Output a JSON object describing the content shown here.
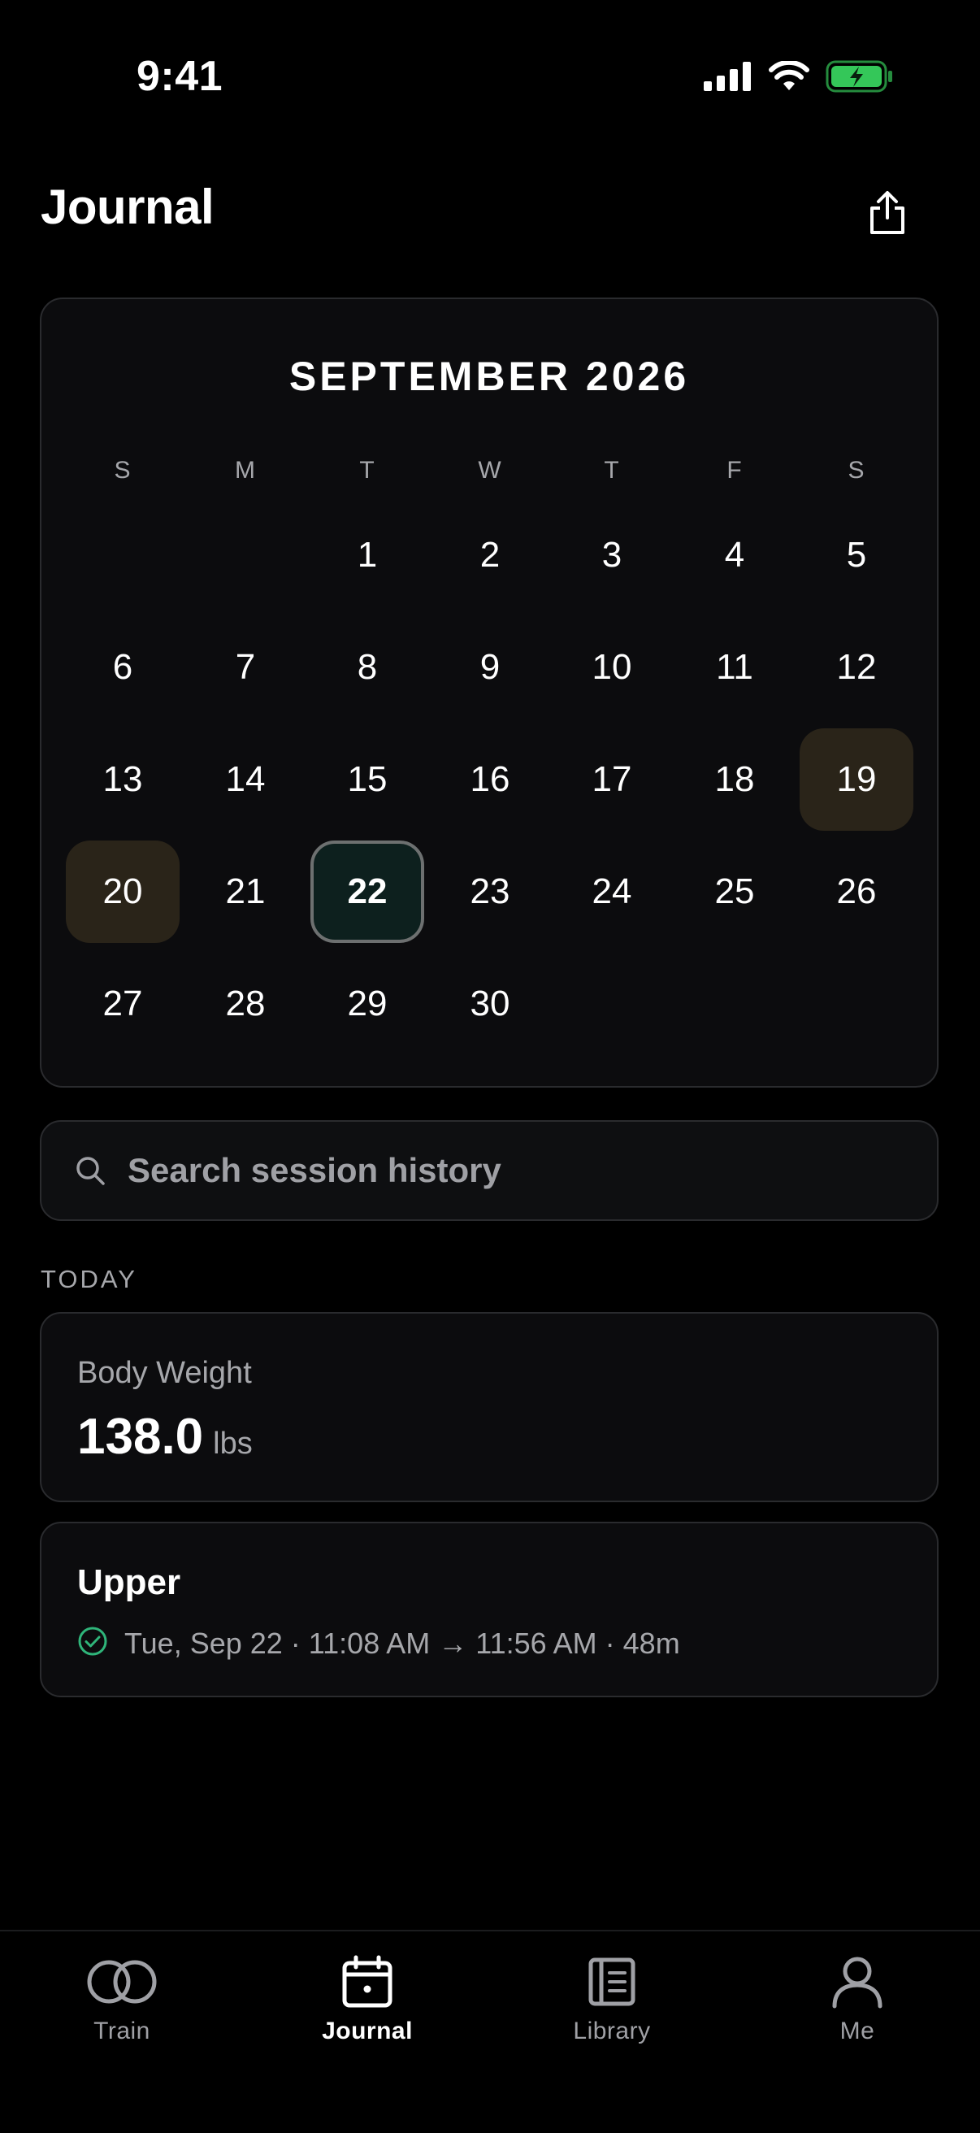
{
  "status_bar": {
    "time": "9:41",
    "icons": [
      "cellular-signal-icon",
      "wifi-icon",
      "battery-charging-icon"
    ],
    "battery_color": "#34c759"
  },
  "header": {
    "title": "Journal",
    "share_icon": "share-icon"
  },
  "calendar": {
    "month_label": "SEPTEMBER 2026",
    "weekdays": [
      "S",
      "M",
      "T",
      "W",
      "T",
      "F",
      "S"
    ],
    "weeks": [
      [
        "",
        "",
        "1",
        "2",
        "3",
        "4",
        "5"
      ],
      [
        "6",
        "7",
        "8",
        "9",
        "10",
        "11",
        "12"
      ],
      [
        "13",
        "14",
        "15",
        "16",
        "17",
        "18",
        "19"
      ],
      [
        "20",
        "21",
        "22",
        "23",
        "24",
        "25",
        "26"
      ],
      [
        "27",
        "28",
        "29",
        "30",
        "",
        "",
        ""
      ]
    ],
    "logged_days": [
      "19",
      "20"
    ],
    "selected_day": "22",
    "colors": {
      "logged_bg": "#2a2419",
      "selected_bg": "#0d201e",
      "selected_border": "#6d7070"
    }
  },
  "search": {
    "placeholder": "Search session history",
    "value": ""
  },
  "today_section": {
    "label": "TODAY",
    "body_weight": {
      "label": "Body Weight",
      "value": "138.0",
      "unit": "lbs"
    },
    "session": {
      "title": "Upper",
      "status_icon": "check-circle-icon",
      "status_color": "#2fb57a",
      "meta": "Tue, Sep 22 · 11:08 AM → 11:56 AM · 48m"
    }
  },
  "tab_bar": {
    "items": [
      {
        "label": "Train",
        "icon": "rings-icon",
        "active": false
      },
      {
        "label": "Journal",
        "icon": "calendar-icon",
        "active": true
      },
      {
        "label": "Library",
        "icon": "book-icon",
        "active": false
      },
      {
        "label": "Me",
        "icon": "person-icon",
        "active": false
      }
    ]
  }
}
